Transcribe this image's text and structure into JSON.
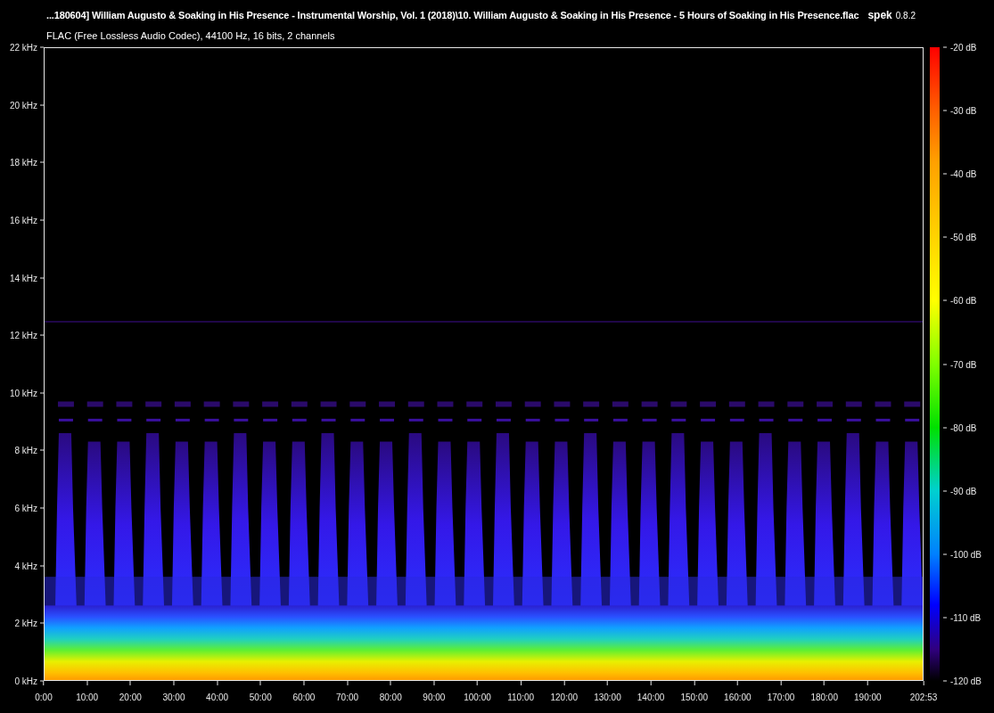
{
  "title": "...180604] William Augusto & Soaking in His Presence - Instrumental Worship, Vol. 1 (2018)\\10. William Augusto & Soaking in His Presence - 5 Hours of Soaking in His Presence.flac",
  "app": {
    "name": "spek",
    "version": "0.8.2"
  },
  "file_info": "FLAC (Free Lossless Audio Codec), 44100 Hz, 16 bits, 2 channels",
  "frequency_axis": [
    "22 kHz",
    "20 kHz",
    "18 kHz",
    "16 kHz",
    "14 kHz",
    "12 kHz",
    "10 kHz",
    "8 kHz",
    "6 kHz",
    "4 kHz",
    "2 kHz",
    "0 kHz"
  ],
  "time_axis": [
    "0:00",
    "10:00",
    "20:00",
    "30:00",
    "40:00",
    "50:00",
    "60:00",
    "70:00",
    "80:00",
    "90:00",
    "100:00",
    "110:00",
    "120:00",
    "130:00",
    "140:00",
    "150:00",
    "160:00",
    "170:00",
    "180:00",
    "190:00",
    "202:53"
  ],
  "db_scale": [
    "-20 dB",
    "-30 dB",
    "-40 dB",
    "-50 dB",
    "-60 dB",
    "-70 dB",
    "-80 dB",
    "-90 dB",
    "-100 dB",
    "-110 dB",
    "-120 dB"
  ]
}
